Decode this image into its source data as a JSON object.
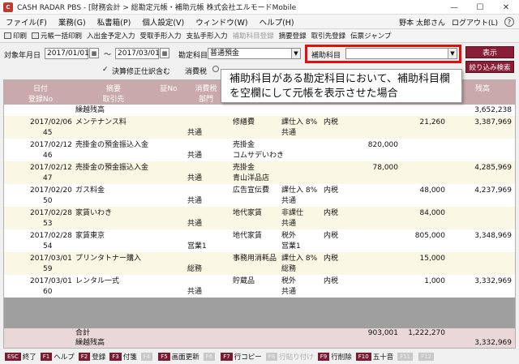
{
  "window": {
    "title": "CASH RADAR PBS - [財務会計 > 総勘定元帳・補助元帳 株式会社エルモードMobile",
    "controls": [
      "—",
      "☐",
      "✕"
    ]
  },
  "menu": {
    "items": [
      "ファイル(F)",
      "業務(G)",
      "私書箱(P)",
      "個人設定(V)",
      "ウィンドウ(W)",
      "ヘルプ(H)"
    ],
    "user": "野本 太郎さん",
    "logout": "ログアウト(L)"
  },
  "toolbar": {
    "items": [
      {
        "label": "印刷",
        "disabled": false
      },
      {
        "label": "元帳一括印刷",
        "disabled": false
      },
      {
        "label": "入出金予定入力",
        "disabled": false
      },
      {
        "label": "受取手形入力",
        "disabled": false
      },
      {
        "label": "支払手形入力",
        "disabled": false
      },
      {
        "label": "補助科目登録",
        "disabled": true
      },
      {
        "label": "摘要登録",
        "disabled": false
      },
      {
        "label": "取引先登録",
        "disabled": false
      },
      {
        "label": "伝票ジャンプ",
        "disabled": false
      }
    ]
  },
  "filter": {
    "period_label": "対象年月日",
    "date_from": "2017/01/01",
    "tilde": "～",
    "date_to": "2017/03/01",
    "account_label": "勘定科目",
    "account_value": "普通預金",
    "sub_account_label": "補助科目",
    "sub_account_value": "",
    "show_button": "表示",
    "filter_button": "絞り込み検索",
    "settlement_check_label": "決算修正仕訳含む",
    "consumption_tax_label": "消費税"
  },
  "callout": {
    "text": "補助科目がある勘定科目において、補助科目欄を空欄にして元帳を表示させた場合"
  },
  "table": {
    "headers": {
      "date": "日付",
      "reg_no": "登録No",
      "summary": "摘要",
      "partner": "取引先",
      "voucher_no": "証No",
      "tax": "消費税",
      "dept": "部門",
      "balance": "残高"
    },
    "carry_forward_label": "繰越残高",
    "carry_forward_balance": "3,652,238",
    "rows": [
      {
        "date": "2017/02/06",
        "reg": "45",
        "summary": "メンテナンス料",
        "dept": "共通",
        "account": "修繕費",
        "account2": "",
        "tax1": "課仕入 8%",
        "tax2": "内税",
        "debit": "",
        "credit": "21,260",
        "balance": "3,387,969"
      },
      {
        "date": "2017/02/12",
        "reg": "46",
        "summary": "売掛金の預金振込入金",
        "dept": "共通",
        "account": "売掛金",
        "account2": "コムサデいわき",
        "tax1": "",
        "tax2": "",
        "debit": "820,000",
        "credit": "",
        "balance": ""
      },
      {
        "date": "2017/02/12",
        "reg": "47",
        "summary": "売掛金の預金振込入金",
        "dept": "共通",
        "account": "売掛金",
        "account2": "青山洋品店",
        "tax1": "",
        "tax2": "",
        "debit": "78,000",
        "credit": "",
        "balance": "4,285,969"
      },
      {
        "date": "2017/02/20",
        "reg": "50",
        "summary": "ガス料金",
        "dept": "共通",
        "account": "広告宣伝費",
        "account2": "",
        "tax1": "課仕入 8%",
        "tax2": "内税",
        "debit": "",
        "credit": "48,000",
        "balance": "4,237,969"
      },
      {
        "date": "2017/02/28",
        "reg": "53",
        "summary": "家賃いわき",
        "dept": "共通",
        "account": "地代家賃",
        "account2": "",
        "tax1": "非課仕",
        "tax2": "内税",
        "debit": "",
        "credit": "84,000",
        "balance": ""
      },
      {
        "date": "2017/02/28",
        "reg": "54",
        "summary": "家賃東京",
        "dept": "営業1",
        "account": "地代家賃",
        "account2": "",
        "tax1": "税外",
        "tax2": "内税",
        "debit": "",
        "credit": "805,000",
        "balance": "3,348,969"
      },
      {
        "date": "2017/03/01",
        "reg": "59",
        "summary": "プリンタトナー購入",
        "dept": "総務",
        "account": "事務用消耗品",
        "account2": "",
        "tax1": "課仕入 8%",
        "tax2": "内税",
        "debit": "",
        "credit": "15,000",
        "balance": ""
      },
      {
        "date": "2017/03/01",
        "reg": "60",
        "summary": "レンタル一式",
        "dept": "共通",
        "account": "貯蔵品",
        "account2": "",
        "tax1": "税外",
        "tax2": "内税",
        "debit": "",
        "credit": "1,000",
        "balance": "3,332,969"
      }
    ],
    "total_label": "合計",
    "total_debit": "903,001",
    "total_credit": "1,222,270",
    "end_label": "繰越残高",
    "end_balance": "3,332,969"
  },
  "fkeys": [
    {
      "key": "ESC",
      "label": "終了",
      "disabled": false
    },
    {
      "key": "F1",
      "label": "ヘルプ",
      "disabled": false
    },
    {
      "key": "F2",
      "label": "登録",
      "disabled": false
    },
    {
      "key": "F3",
      "label": "付箋",
      "disabled": false
    },
    {
      "key": "F4",
      "label": "",
      "disabled": true
    },
    {
      "key": "F5",
      "label": "画面更新",
      "disabled": false
    },
    {
      "key": "F6",
      "label": "",
      "disabled": true
    },
    {
      "key": "F7",
      "label": "行コピー",
      "disabled": false
    },
    {
      "key": "F8",
      "label": "行貼り付け",
      "disabled": true
    },
    {
      "key": "F9",
      "label": "行削除",
      "disabled": false
    },
    {
      "key": "F10",
      "label": "五十音",
      "disabled": false
    },
    {
      "key": "F11",
      "label": "",
      "disabled": true
    },
    {
      "key": "F12",
      "label": "",
      "disabled": true
    }
  ]
}
